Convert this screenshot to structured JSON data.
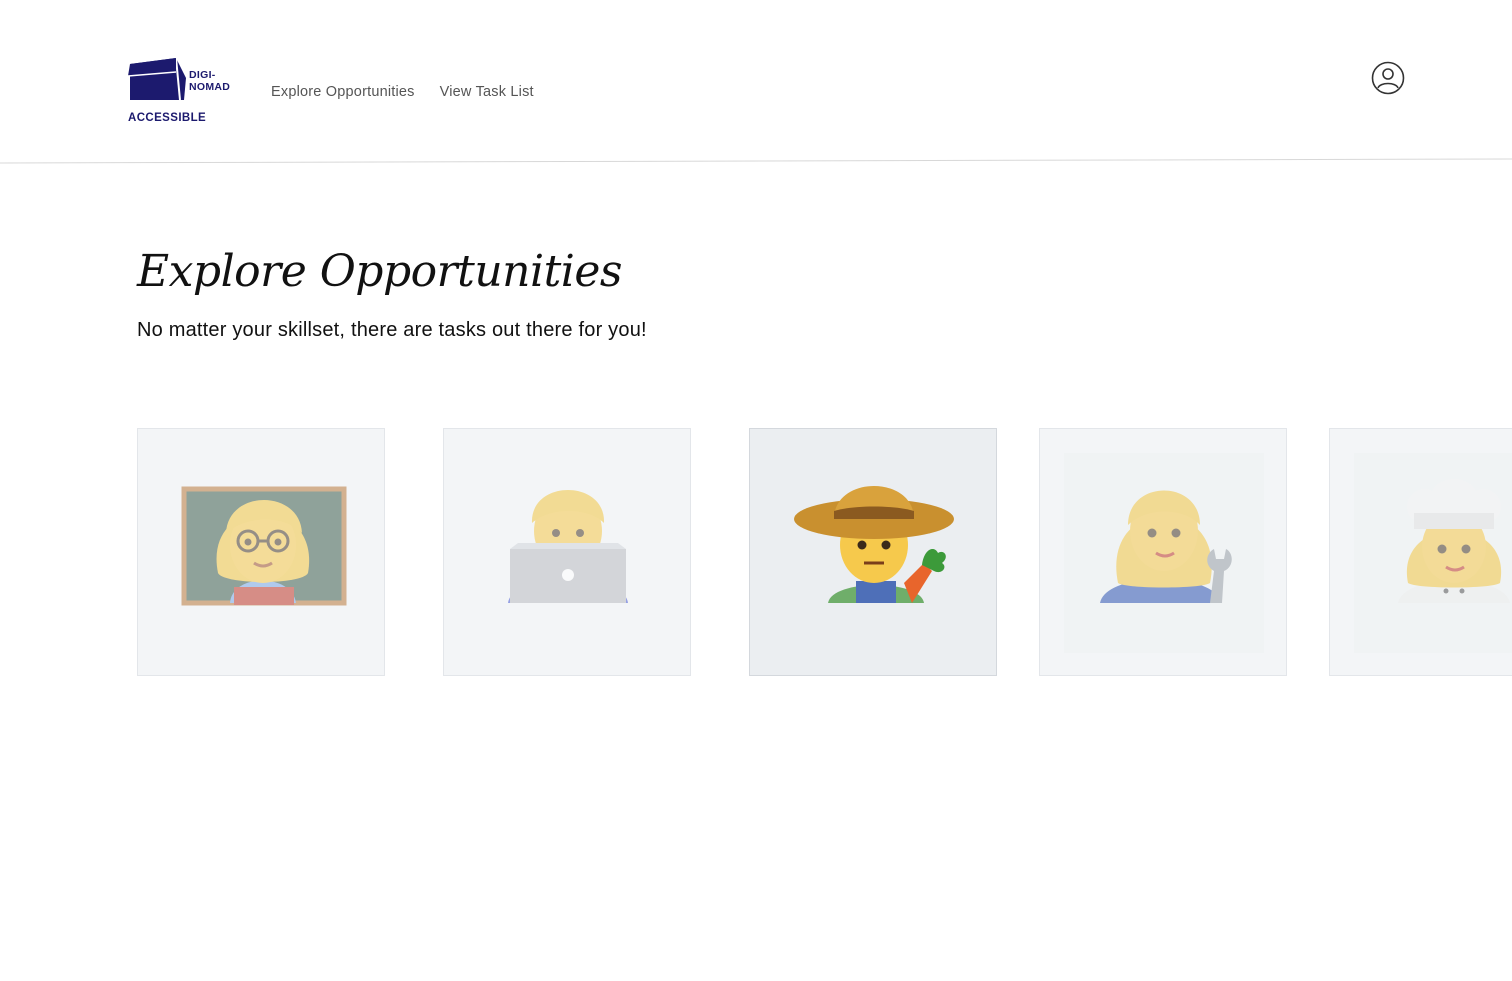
{
  "app": {
    "logo_top_line1": "DIGI-",
    "logo_top_line2": "NOMAD",
    "logo_bottom": "ACCESSIBLE",
    "brand_color": "#1c1a6e"
  },
  "nav": {
    "items": [
      {
        "label": "Explore Opportunities"
      },
      {
        "label": "View Task List"
      }
    ]
  },
  "header": {
    "account_icon": "user-circle-icon"
  },
  "main": {
    "title": "Explore Opportunities",
    "subtitle": "No matter your skillset, there are tasks out there for you!"
  },
  "cards": [
    {
      "icon": "teacher-emoji-icon",
      "state": "faded"
    },
    {
      "icon": "technologist-emoji-icon",
      "state": "faded"
    },
    {
      "icon": "farmer-emoji-icon",
      "state": "active"
    },
    {
      "icon": "mechanic-emoji-icon",
      "state": "faded"
    },
    {
      "icon": "cook-emoji-icon",
      "state": "faded"
    }
  ]
}
